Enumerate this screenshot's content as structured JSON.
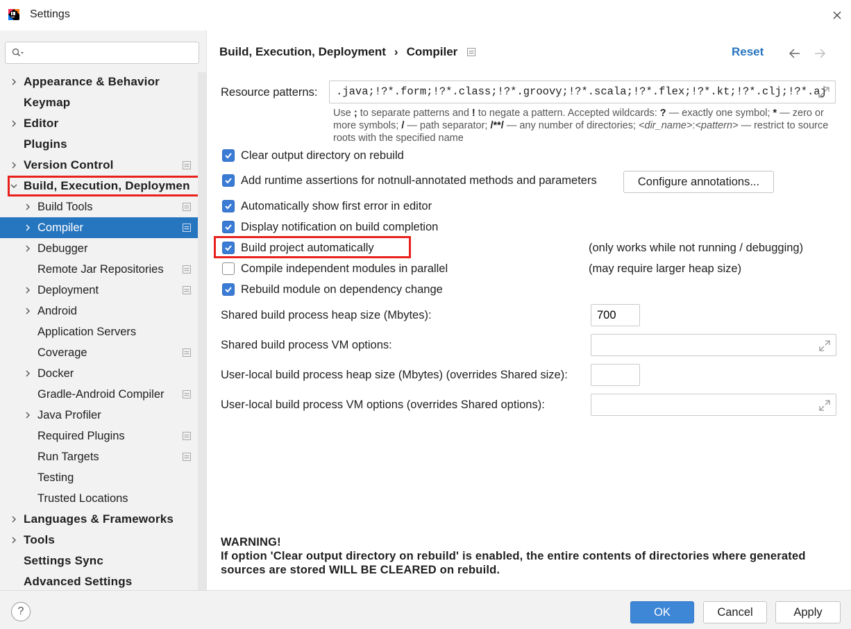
{
  "window": {
    "title": "Settings"
  },
  "search": {
    "value": "",
    "placeholder": ""
  },
  "sidebar": {
    "items": [
      {
        "label": "Appearance & Behavior",
        "level": 0,
        "expandable": true,
        "project": false
      },
      {
        "label": "Keymap",
        "level": 0,
        "expandable": false,
        "project": false
      },
      {
        "label": "Editor",
        "level": 0,
        "expandable": true,
        "project": false
      },
      {
        "label": "Plugins",
        "level": 0,
        "expandable": false,
        "project": false
      },
      {
        "label": "Version Control",
        "level": 0,
        "expandable": true,
        "project": true
      },
      {
        "label": "Build, Execution, Deploymen",
        "level": 0,
        "expandable": true,
        "expanded": true,
        "project": false
      },
      {
        "label": "Build Tools",
        "level": 1,
        "expandable": true,
        "project": true
      },
      {
        "label": "Compiler",
        "level": 1,
        "expandable": true,
        "project": true,
        "selected": true
      },
      {
        "label": "Debugger",
        "level": 1,
        "expandable": true,
        "project": false
      },
      {
        "label": "Remote Jar Repositories",
        "level": 1,
        "expandable": false,
        "project": true
      },
      {
        "label": "Deployment",
        "level": 1,
        "expandable": true,
        "project": true
      },
      {
        "label": "Android",
        "level": 1,
        "expandable": true,
        "project": false
      },
      {
        "label": "Application Servers",
        "level": 1,
        "expandable": false,
        "project": false
      },
      {
        "label": "Coverage",
        "level": 1,
        "expandable": false,
        "project": true
      },
      {
        "label": "Docker",
        "level": 1,
        "expandable": true,
        "project": false
      },
      {
        "label": "Gradle-Android Compiler",
        "level": 1,
        "expandable": false,
        "project": true
      },
      {
        "label": "Java Profiler",
        "level": 1,
        "expandable": true,
        "project": false
      },
      {
        "label": "Required Plugins",
        "level": 1,
        "expandable": false,
        "project": true
      },
      {
        "label": "Run Targets",
        "level": 1,
        "expandable": false,
        "project": true
      },
      {
        "label": "Testing",
        "level": 1,
        "expandable": false,
        "project": false
      },
      {
        "label": "Trusted Locations",
        "level": 1,
        "expandable": false,
        "project": false
      },
      {
        "label": "Languages & Frameworks",
        "level": 0,
        "expandable": true,
        "project": false
      },
      {
        "label": "Tools",
        "level": 0,
        "expandable": true,
        "project": false
      },
      {
        "label": "Settings Sync",
        "level": 0,
        "expandable": false,
        "project": false
      },
      {
        "label": "Advanced Settings",
        "level": 0,
        "expandable": false,
        "project": false
      }
    ]
  },
  "header": {
    "crumb1": "Build, Execution, Deployment",
    "separator": "›",
    "crumb2": "Compiler",
    "reset": "Reset"
  },
  "compiler": {
    "resource_patterns_label": "Resource patterns:",
    "resource_patterns_value": ".java;!?*.form;!?*.class;!?*.groovy;!?*.scala;!?*.flex;!?*.kt;!?*.clj;!?*.aj",
    "hint": {
      "p1": "Use ",
      "b1": ";",
      "p2": " to separate patterns and ",
      "b2": "!",
      "p3": " to negate a pattern. Accepted wildcards: ",
      "b3": "?",
      "p4": " — exactly one symbol; ",
      "b4": "*",
      "p5": " — zero or more symbols; ",
      "b5": "/",
      "p6": " — path separator; ",
      "b6": "/**/",
      "p7": " — any number of directories; ",
      "i1": "<dir_name>",
      "p8": ":",
      "i2": "<pattern>",
      "p9": " — restrict to source roots with the specified name"
    },
    "options": [
      {
        "label": "Clear output directory on rebuild",
        "checked": true
      },
      {
        "label": "Add runtime assertions for notnull-annotated methods and parameters",
        "checked": true
      },
      {
        "label": "Automatically show first error in editor",
        "checked": true
      },
      {
        "label": "Display notification on build completion",
        "checked": true
      },
      {
        "label": "Build project automatically",
        "checked": true
      },
      {
        "label": "Compile independent modules in parallel",
        "checked": false
      },
      {
        "label": "Rebuild module on dependency change",
        "checked": true
      }
    ],
    "configure_annotations": "Configure annotations...",
    "note_build_auto": "(only works while not running / debugging)",
    "note_parallel": "(may require larger heap size)",
    "heap_label": "Shared build process heap size (Mbytes):",
    "heap_value": "700",
    "vm_label": "Shared build process VM options:",
    "vm_value": "",
    "local_heap_label": "User-local build process heap size (Mbytes) (overrides Shared size):",
    "local_heap_value": "",
    "local_vm_label": "User-local build process VM options (overrides Shared options):",
    "local_vm_value": "",
    "warning_title": "WARNING!",
    "warning_text": "If option 'Clear output directory on rebuild' is enabled, the entire contents of directories where generated sources are stored WILL BE CLEARED on rebuild."
  },
  "footer": {
    "help": "?",
    "ok": "OK",
    "cancel": "Cancel",
    "apply": "Apply"
  },
  "colors": {
    "accent": "#2675bf",
    "highlight_outline": "#e8211d",
    "checkbox": "#3a7bd5"
  }
}
